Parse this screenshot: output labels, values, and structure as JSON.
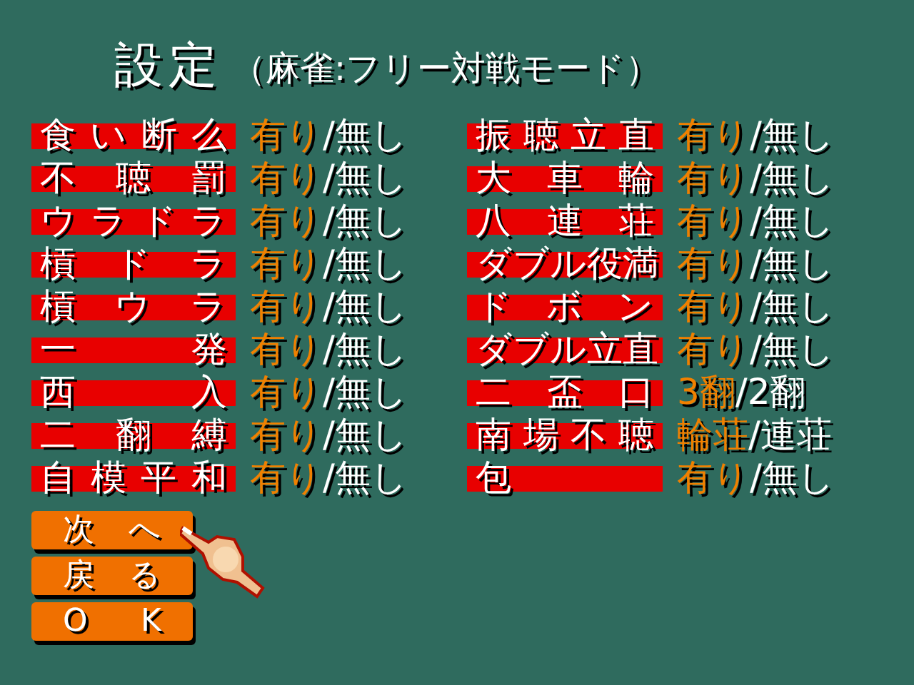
{
  "title": "設定",
  "subtitle": "（麻雀:フリー対戦モード）",
  "settings": [
    [
      {
        "label": "食い断么",
        "separator": "/",
        "options": [
          {
            "text": "有り",
            "selected": true
          },
          {
            "text": "無し",
            "selected": false
          }
        ]
      },
      {
        "label": "振聴立直",
        "separator": "/",
        "options": [
          {
            "text": "有り",
            "selected": true
          },
          {
            "text": "無し",
            "selected": false
          }
        ]
      }
    ],
    [
      {
        "label": "不 聴 罰",
        "separator": "/",
        "options": [
          {
            "text": "有り",
            "selected": true
          },
          {
            "text": "無し",
            "selected": false
          }
        ]
      },
      {
        "label": "大 車 輪",
        "separator": "/",
        "options": [
          {
            "text": "有り",
            "selected": true
          },
          {
            "text": "無し",
            "selected": false
          }
        ]
      }
    ],
    [
      {
        "label": "ウラドラ",
        "separator": "/",
        "options": [
          {
            "text": "有り",
            "selected": true
          },
          {
            "text": "無し",
            "selected": false
          }
        ]
      },
      {
        "label": "八 連 荘",
        "separator": "/",
        "options": [
          {
            "text": "有り",
            "selected": true
          },
          {
            "text": "無し",
            "selected": false
          }
        ]
      }
    ],
    [
      {
        "label": "槓 ド ラ",
        "separator": "/",
        "options": [
          {
            "text": "有り",
            "selected": true
          },
          {
            "text": "無し",
            "selected": false
          }
        ]
      },
      {
        "label": "ダブル役満",
        "separator": "/",
        "options": [
          {
            "text": "有り",
            "selected": true
          },
          {
            "text": "無し",
            "selected": false
          }
        ]
      }
    ],
    [
      {
        "label": "槓 ウ ラ",
        "separator": "/",
        "options": [
          {
            "text": "有り",
            "selected": true
          },
          {
            "text": "無し",
            "selected": false
          }
        ]
      },
      {
        "label": "ド ボ ン",
        "separator": "/",
        "options": [
          {
            "text": "有り",
            "selected": true
          },
          {
            "text": "無し",
            "selected": false
          }
        ]
      }
    ],
    [
      {
        "label": "一 発",
        "separator": "/",
        "options": [
          {
            "text": "有り",
            "selected": true
          },
          {
            "text": "無し",
            "selected": false
          }
        ]
      },
      {
        "label": "ダブル立直",
        "separator": "/",
        "options": [
          {
            "text": "有り",
            "selected": true
          },
          {
            "text": "無し",
            "selected": false
          }
        ]
      }
    ],
    [
      {
        "label": "西 入",
        "separator": "/",
        "options": [
          {
            "text": "有り",
            "selected": true
          },
          {
            "text": "無し",
            "selected": false
          }
        ]
      },
      {
        "label": "二 盃 口",
        "separator": "/",
        "options": [
          {
            "text": "3翻",
            "selected": true
          },
          {
            "text": "2翻",
            "selected": false
          }
        ]
      }
    ],
    [
      {
        "label": "二 翻 縛",
        "separator": "/",
        "options": [
          {
            "text": "有り",
            "selected": true
          },
          {
            "text": "無し",
            "selected": false
          }
        ]
      },
      {
        "label": "南場不聴",
        "separator": "/",
        "options": [
          {
            "text": "輪荘",
            "selected": true
          },
          {
            "text": "連荘",
            "selected": false
          }
        ]
      }
    ],
    [
      {
        "label": "自模平和",
        "separator": "/",
        "options": [
          {
            "text": "有り",
            "selected": true
          },
          {
            "text": "無し",
            "selected": false
          }
        ]
      },
      {
        "label": "包",
        "separator": "/",
        "options": [
          {
            "text": "有り",
            "selected": true
          },
          {
            "text": "無し",
            "selected": false
          }
        ]
      }
    ]
  ],
  "buttons": [
    {
      "label": "次 へ",
      "selected": true
    },
    {
      "label": "戻 る",
      "selected": false
    },
    {
      "label": "O K",
      "selected": false
    }
  ]
}
